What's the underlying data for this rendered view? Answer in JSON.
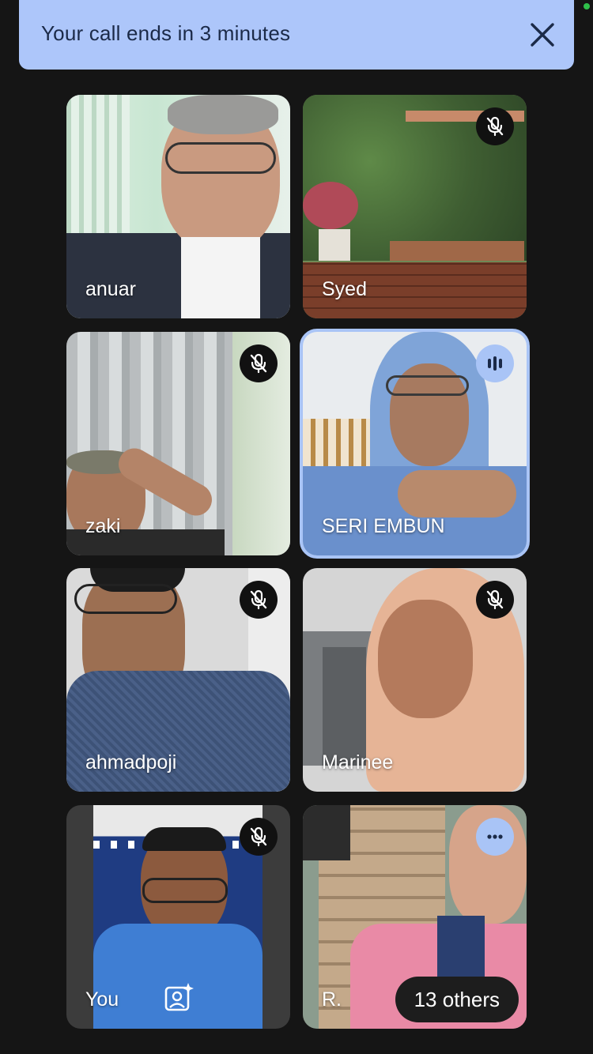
{
  "banner": {
    "text": "Your call ends in 3 minutes",
    "close_icon": "close-icon"
  },
  "participants": [
    {
      "name": "anuar",
      "muted": false
    },
    {
      "name": "Syed",
      "muted": true
    },
    {
      "name": "zaki",
      "muted": true
    },
    {
      "name": "SERI EMBUN",
      "muted": false,
      "speaking": true
    },
    {
      "name": "ahmadpoji",
      "muted": true
    },
    {
      "name": "Marinee",
      "muted": true
    },
    {
      "name": "You",
      "muted": true,
      "self": true
    },
    {
      "name": "R.",
      "muted": false
    }
  ],
  "overflow": {
    "label": "13 others"
  },
  "colors": {
    "background": "#151515",
    "banner": "#adc6fa",
    "active_border": "#a9c4f6",
    "status_dot": "#2fbf4a"
  }
}
